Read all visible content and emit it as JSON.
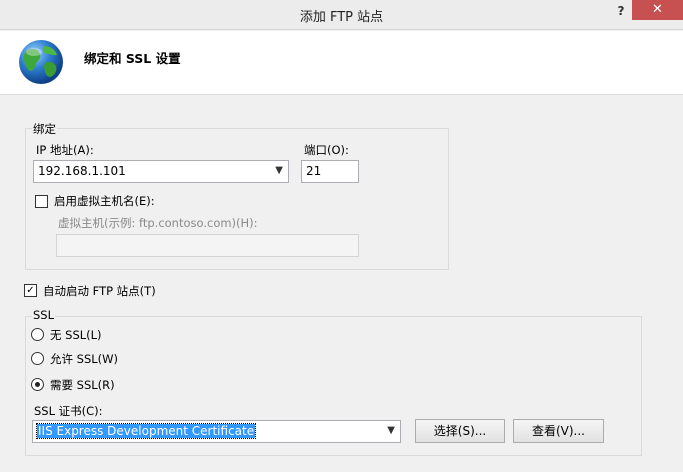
{
  "window": {
    "title": "添加 FTP 站点",
    "help_label": "?",
    "close_label": "✕"
  },
  "header": {
    "title": "绑定和 SSL 设置",
    "icon": "globe-icon"
  },
  "binding": {
    "group_label": "绑定",
    "ip_label": "IP 地址(A):",
    "ip_value": "192.168.1.101",
    "port_label": "端口(O):",
    "port_value": "21",
    "virtual_host_check_label": "启用虚拟主机名(E):",
    "virtual_host_checked": false,
    "virtual_host_label": "虚拟主机(示例: ftp.contoso.com)(H):",
    "virtual_host_value": ""
  },
  "auto_start": {
    "label": "自动启动 FTP 站点(T)",
    "checked": true
  },
  "ssl": {
    "group_label": "SSL",
    "options": [
      {
        "label": "无 SSL(L)",
        "selected": false
      },
      {
        "label": "允许 SSL(W)",
        "selected": false
      },
      {
        "label": "需要 SSL(R)",
        "selected": true
      }
    ],
    "cert_label": "SSL 证书(C):",
    "cert_value": "IIS Express Development Certificate",
    "select_button": "选择(S)...",
    "view_button": "查看(V)..."
  },
  "colors": {
    "close_button": "#c75050",
    "selection": "#3399ff"
  }
}
